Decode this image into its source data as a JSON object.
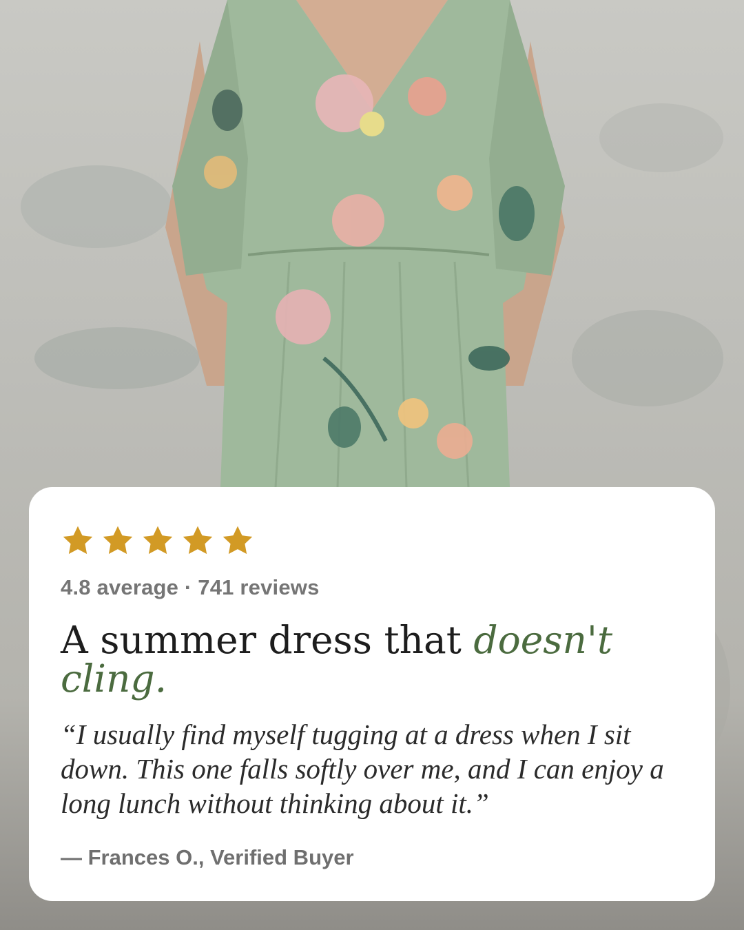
{
  "review": {
    "stars": 5,
    "star_color": "#d29a25",
    "rating_summary": "4.8 average · 741 reviews",
    "headline_plain": "A summer dress that ",
    "headline_accent": "doesn't cling.",
    "accent_color": "#4b6b3f",
    "quote": "“I usually find myself tugging at a dress when I sit down. This one falls softly over me, and I can enjoy a long lunch without thinking about it.”",
    "attribution": "— Frances O., Verified Buyer"
  },
  "hero": {
    "subject": "model-in-green-floral-dress-photo"
  }
}
